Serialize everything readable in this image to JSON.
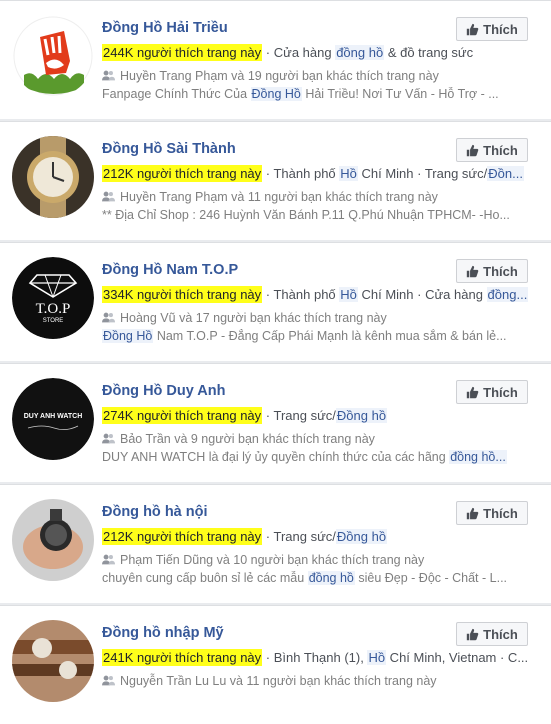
{
  "like_label": "Thích",
  "highlight_color": "#ffff1a",
  "link_color": "#365899",
  "results": [
    {
      "title": "Đồng Hồ Hải Triều",
      "likes": "244K người thích trang này",
      "meta_parts": [
        " · Cửa hàng ",
        "đồng hồ",
        " & đồ trang sức"
      ],
      "friends": "Huyền Trang Phạm và 19 người bạn khác thích trang này",
      "desc_parts": [
        "Fanpage Chính Thức Của ",
        "Đồng Hồ",
        " Hải Triều! Nơi Tư Vấn - Hỗ Trợ - ..."
      ]
    },
    {
      "title": "Đồng Hồ Sài Thành",
      "likes": "212K người thích trang này",
      "meta_parts": [
        " · Thành phố ",
        "Hồ",
        " Chí Minh · Trang sức/",
        "Đồn..."
      ],
      "friends": "Huyền Trang Phạm và 11 người bạn khác thích trang này",
      "desc_parts": [
        "** Địa Chỉ Shop : 246 Huỳnh Văn Bánh P.11 Q.Phú Nhuận TPHCM- -Ho..."
      ]
    },
    {
      "title": "Đồng Hồ Nam T.O.P",
      "likes": "334K người thích trang này",
      "meta_parts": [
        " · Thành phố ",
        "Hồ",
        " Chí Minh · Cửa hàng ",
        "đồng..."
      ],
      "friends": "Hoàng Vũ và 17 người bạn khác thích trang này",
      "desc_parts": [
        "",
        "Đồng Hồ",
        " Nam T.O.P - Đẳng Cấp Phái Mạnh là kênh mua sắm & bán lẻ..."
      ]
    },
    {
      "title": "Đồng Hồ Duy Anh",
      "likes": "274K người thích trang này",
      "meta_parts": [
        " · Trang sức/",
        "Đồng hồ"
      ],
      "friends": "Bảo Trần và 9 người bạn khác thích trang này",
      "desc_parts": [
        "DUY ANH WATCH là đại lý ủy quyền chính thức của các hãng ",
        "đồng hồ..."
      ]
    },
    {
      "title": "Đồng hồ hà nội",
      "likes": "212K người thích trang này",
      "meta_parts": [
        " · Trang sức/",
        "Đồng hồ"
      ],
      "friends": "Phạm Tiến Dũng và 10 người bạn khác thích trang này",
      "desc_parts": [
        "chuyên cung cấp buôn sỉ lẻ các mẫu ",
        "đồng hồ",
        " siêu Đẹp - Độc - Chất - L..."
      ]
    },
    {
      "title": "Đồng hồ nhập Mỹ",
      "likes": "241K người thích trang này",
      "meta_parts": [
        " · Bình Thạnh (1), ",
        "Hồ",
        " Chí Minh, Vietnam · C..."
      ],
      "friends": "Nguyễn Trần Lu Lu và 11 người bạn khác thích trang này",
      "desc_parts": [
        ""
      ]
    }
  ],
  "avatar_texts": {
    "top_store": "T.O.P",
    "top_store_sub": "STORE",
    "duy_anh": "DUY ANH WATCH"
  }
}
